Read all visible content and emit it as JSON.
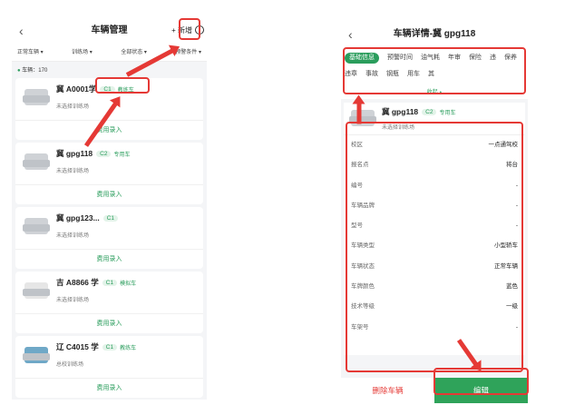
{
  "left": {
    "title": "车辆管理",
    "new_label": "+ 新增",
    "filters": [
      "正常车辆 ▾",
      "训练场 ▾",
      "全部状态 ▾",
      "预警条件 ▾"
    ],
    "count": "车辆：170",
    "cards": [
      {
        "plate": "冀 A0001学",
        "class": "C1",
        "type": "教练车",
        "sub": "未选择训练场",
        "fee": "费用录入"
      },
      {
        "plate": "冀 gpg118",
        "class": "C2",
        "type": "专用车",
        "sub": "未选择训练场",
        "fee": "费用录入"
      },
      {
        "plate": "冀 gpg123...",
        "class": "C1",
        "type": "",
        "sub": "未选择训练场",
        "fee": "费用录入"
      },
      {
        "plate": "吉 A8866 学",
        "class": "C1",
        "type": "模拟车",
        "sub": "未选择训练场",
        "fee": "费用录入"
      },
      {
        "plate": "辽 C4015 学",
        "class": "C1",
        "type": "教练车",
        "sub": "总校训练场",
        "fee": "费用录入"
      }
    ]
  },
  "right": {
    "title": "车辆详情-冀 gpg118",
    "tabs": [
      "基础信息",
      "预警时间",
      "油气耗",
      "年审",
      "保险",
      "违",
      "保养",
      "违章",
      "事故",
      "钢瓶",
      "用车",
      "其"
    ],
    "fold": "收起 ▴",
    "plate": "冀 gpg118",
    "class": "C2",
    "type": "专用车",
    "sub": "未选择训练场",
    "rows": [
      [
        "校区",
        "一点通驾校"
      ],
      [
        "报名点",
        "将台"
      ],
      [
        "编号",
        "-"
      ],
      [
        "车辆品牌",
        "-"
      ],
      [
        "型号",
        "-"
      ],
      [
        "车辆类型",
        "小型轿车"
      ],
      [
        "车辆状态",
        "正常车辆"
      ],
      [
        "车牌颜色",
        "蓝色"
      ],
      [
        "技术等级",
        "一级"
      ],
      [
        "车架号",
        "-"
      ]
    ],
    "delete": "删除车辆",
    "edit": "编辑"
  }
}
